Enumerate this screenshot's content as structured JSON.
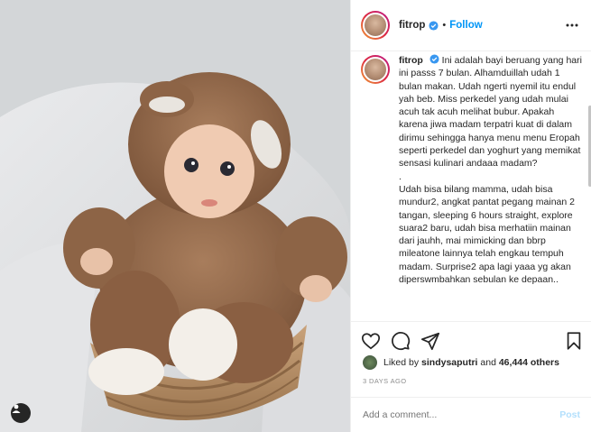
{
  "post": {
    "username": "fitrop",
    "follow_label": "Follow",
    "separator": "•",
    "caption_username": "fitrop",
    "caption_body": "Ini adalah bayi beruang yang hari ini passs 7 bulan. Alhamduillah udah 1 bulan makan. Udah ngerti nyemil itu endul yah beb. Miss perkedel yang udah mulai acuh tak acuh melihat bubur. Apakah karena jiwa madam terpatri kuat di dalam dirimu sehingga hanya menu menu Eropah seperti perkedel dan yoghurt yang memikat sensasi kulinari andaaa madam?\n.\nUdah bisa bilang mamma, udah bisa mundur2, angkat pantat pegang mainan 2 tangan, sleeping 6 hours straight, explore suara2 baru, udah bisa merhatiin mainan dari jauhh, mai mimicking dan bbrp mileatone lainnya telah engkau tempuh madam. Surprise2 apa lagi yaaa yg akan diperswmbahkan sebulan ke depaan..",
    "likes_prefix": "Liked by",
    "liked_by_user": "sindysaputri",
    "likes_and": "and",
    "likes_count": "46,444 others",
    "date": "3 DAYS AGO",
    "comment_placeholder": "Add a comment...",
    "post_button": "Post"
  },
  "icons": {
    "verified": "verified-badge-icon",
    "more": "more-options-icon",
    "like": "heart-icon",
    "comment": "comment-icon",
    "share": "share-icon",
    "save": "bookmark-icon",
    "tag": "user-tag-icon"
  },
  "colors": {
    "accent": "#0095f6",
    "verified": "#3897f0",
    "post_disabled": "#b2dffc",
    "muted": "#8e8e8e"
  }
}
